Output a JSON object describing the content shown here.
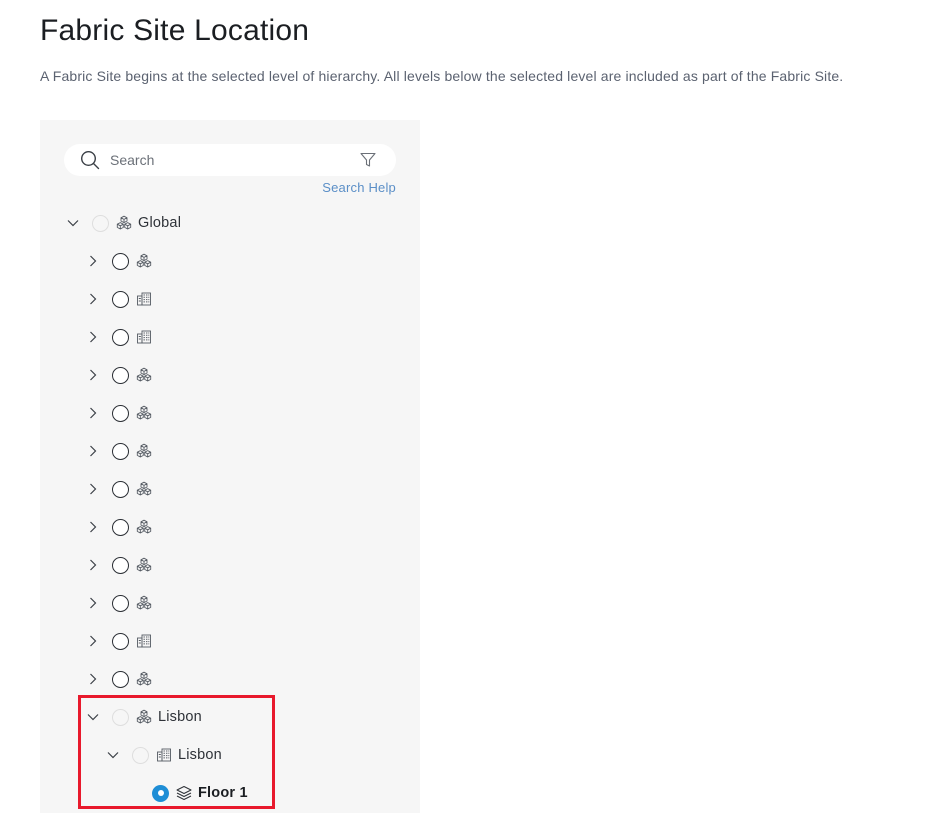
{
  "page": {
    "title": "Fabric Site Location",
    "subtitle": "A Fabric Site begins at the selected level of hierarchy. All levels below the selected level are included as part of the Fabric Site."
  },
  "search": {
    "placeholder": "Search",
    "help_label": "Search Help"
  },
  "tree": {
    "root": {
      "label": "Global",
      "icon": "area-icon",
      "expanded": true,
      "selectable": false
    },
    "children": [
      {
        "label": "",
        "icon": "area-icon",
        "expanded": false
      },
      {
        "label": "",
        "icon": "building-icon",
        "expanded": false
      },
      {
        "label": "",
        "icon": "building-icon",
        "expanded": false
      },
      {
        "label": "",
        "icon": "area-icon",
        "expanded": false
      },
      {
        "label": "",
        "icon": "area-icon",
        "expanded": false
      },
      {
        "label": "",
        "icon": "area-icon",
        "expanded": false
      },
      {
        "label": "",
        "icon": "area-icon",
        "expanded": false
      },
      {
        "label": "",
        "icon": "area-icon",
        "expanded": false
      },
      {
        "label": "",
        "icon": "area-icon",
        "expanded": false
      },
      {
        "label": "",
        "icon": "area-icon",
        "expanded": false
      },
      {
        "label": "",
        "icon": "building-icon",
        "expanded": false
      },
      {
        "label": "",
        "icon": "area-icon",
        "expanded": false
      }
    ],
    "lisbon_area": {
      "label": "Lisbon",
      "icon": "area-icon",
      "expanded": true
    },
    "lisbon_building": {
      "label": "Lisbon",
      "icon": "building-icon",
      "expanded": true
    },
    "floor": {
      "label": "Floor 1",
      "icon": "floor-icon",
      "selected": true
    }
  },
  "colors": {
    "accent": "#1e8ed6",
    "link": "#5b8fc7",
    "highlight": "#e8192c",
    "panel_bg": "#f6f6f6"
  }
}
